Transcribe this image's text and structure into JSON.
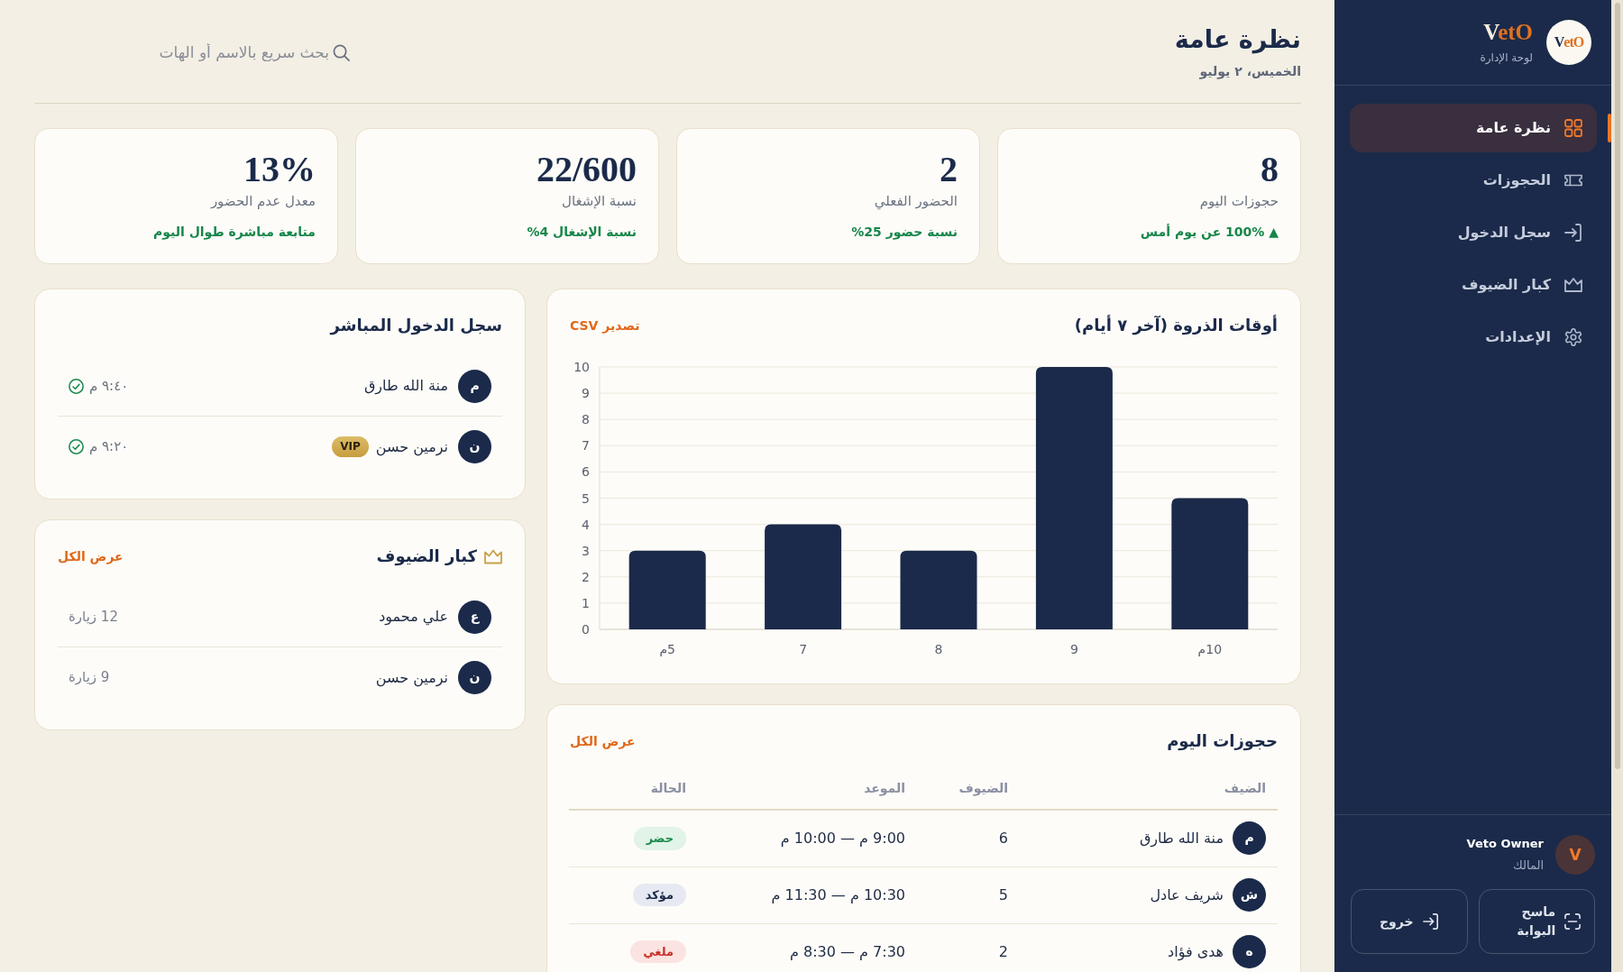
{
  "sidebar": {
    "logo": {
      "lead": "V",
      "accent": "etO"
    },
    "brand": {
      "lead": "V",
      "accent": "etO"
    },
    "subtitle": "لوحة الإدارة",
    "nav": [
      {
        "label": "نظرة عامة",
        "selected": true
      },
      {
        "label": "الحجوزات",
        "selected": false
      },
      {
        "label": "سجل الدخول",
        "selected": false
      },
      {
        "label": "كبار الضيوف",
        "selected": false
      },
      {
        "label": "الإعدادات",
        "selected": false
      }
    ],
    "user": {
      "initial": "V",
      "name": "Veto Owner",
      "role": "المالك"
    },
    "buttons": [
      {
        "label": "ماسح البوابة"
      },
      {
        "label": "خروج"
      }
    ]
  },
  "header": {
    "title": "نظرة عامة",
    "date": "الخميس، ٢ يوليو",
    "search": {
      "placeholder": "بحث سريع بالاسم أو الهات"
    }
  },
  "stats": [
    {
      "value": "8",
      "label": "حجوزات اليوم",
      "note": "▲ 100% عن يوم أمس"
    },
    {
      "value": "2",
      "label": "الحضور الفعلي",
      "note": "نسبة حضور 25%"
    },
    {
      "value": "22/600",
      "label": "نسبة الإشغال",
      "note": "نسبة الإشغال 4%"
    },
    {
      "value": "13%",
      "label": "معدل عدم الحضور",
      "note": "متابعة مباشرة طوال اليوم"
    }
  ],
  "peak_hours": {
    "action": "تصدير CSV",
    "chart_data": {
      "type": "bar",
      "title": "أوقات الذروة (آخر ٧ أيام)",
      "categories": [
        "5م",
        "7",
        "8",
        "9",
        "10م"
      ],
      "values": [
        3,
        4,
        3,
        10,
        5
      ],
      "ylim": [
        0,
        10
      ],
      "yticks": [
        {
          "value": 0,
          "label": "0"
        },
        {
          "value": 1,
          "label": "1"
        },
        {
          "value": 2,
          "label": "2"
        },
        {
          "value": 3,
          "label": "3"
        },
        {
          "value": 4,
          "label": "4"
        },
        {
          "value": 5,
          "label": "5"
        },
        {
          "value": 6,
          "label": "6"
        },
        {
          "value": 7,
          "label": "7"
        },
        {
          "value": 8,
          "label": "8"
        },
        {
          "value": 9,
          "label": "9"
        },
        {
          "value": 10,
          "label": "10"
        }
      ],
      "grid": true
    }
  },
  "todays_bookings": {
    "title": "حجوزات اليوم",
    "action": "عرض الكل",
    "columns": [
      "الضيف",
      "الضيوف",
      "الموعد",
      "الحالة"
    ],
    "rows": [
      {
        "initial": "م",
        "guest": "منة الله طارق",
        "party": "6",
        "time": "9:00 م — 10:00 م",
        "status": "حضر",
        "kind": "attended"
      },
      {
        "initial": "ش",
        "guest": "شريف عادل",
        "party": "5",
        "time": "10:30 م — 11:30 م",
        "status": "مؤكد",
        "kind": "confirmed"
      },
      {
        "initial": "ه",
        "guest": "هدى فؤاد",
        "party": "2",
        "time": "7:30 م — 8:30 م",
        "status": "ملغي",
        "kind": "cancelled"
      }
    ]
  },
  "live_checkins": {
    "title": "سجل الدخول المباشر",
    "items": [
      {
        "initial": "م",
        "name": "منة الله طارق",
        "time": "٩:٤٠ م"
      },
      {
        "initial": "ن",
        "name": "نرمين حسن",
        "badge": "VIP",
        "time": "٩:٢٠ م"
      }
    ]
  },
  "vip_guests": {
    "title": "كبار الضيوف",
    "action": "عرض الكل",
    "items": [
      {
        "initial": "ع",
        "name": "علي محمود",
        "visits": "12 زيارة"
      },
      {
        "initial": "ن",
        "name": "نرمين حسن",
        "visits": "9 زيارة"
      }
    ]
  }
}
